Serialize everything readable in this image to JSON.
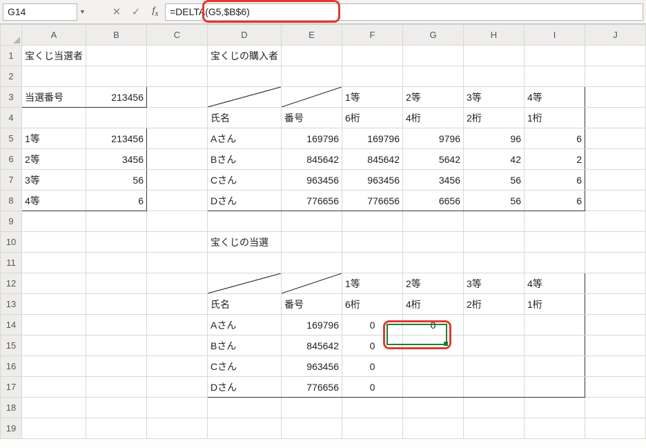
{
  "nameBox": "G14",
  "formula": "=DELTA(G5,$B$6)",
  "columns": [
    "A",
    "B",
    "C",
    "D",
    "E",
    "F",
    "G",
    "H",
    "I",
    "J"
  ],
  "rows": [
    "1",
    "2",
    "3",
    "4",
    "5",
    "6",
    "7",
    "8",
    "9",
    "10",
    "11",
    "12",
    "13",
    "14",
    "15",
    "16",
    "17",
    "18",
    "19"
  ],
  "selectedCol": "G",
  "selectedRow": "14",
  "titles": {
    "winners": "宝くじ当選者",
    "buyers": "宝くじの購入者",
    "results": "宝くじの当選"
  },
  "labels": {
    "winNo": "当選番号",
    "name": "氏名",
    "number": "番号",
    "p1": "1等",
    "p2": "2等",
    "p3": "3等",
    "p4": "4等",
    "d6": "6桁",
    "d4": "4桁",
    "d2": "2桁",
    "d1": "1桁"
  },
  "winNumber": "213456",
  "prizes": [
    {
      "rank": "1等",
      "num": "213456"
    },
    {
      "rank": "2等",
      "num": "3456"
    },
    {
      "rank": "3等",
      "num": "56"
    },
    {
      "rank": "4等",
      "num": "6"
    }
  ],
  "buyers": [
    {
      "name": "Aさん",
      "num": "169796",
      "d6": "169796",
      "d4": "9796",
      "d2": "96",
      "d1": "6"
    },
    {
      "name": "Bさん",
      "num": "845642",
      "d6": "845642",
      "d4": "5642",
      "d2": "42",
      "d1": "2"
    },
    {
      "name": "Cさん",
      "num": "963456",
      "d6": "963456",
      "d4": "3456",
      "d2": "56",
      "d1": "6"
    },
    {
      "name": "Dさん",
      "num": "776656",
      "d6": "776656",
      "d4": "6656",
      "d2": "56",
      "d1": "6"
    }
  ],
  "results": [
    {
      "name": "Aさん",
      "num": "169796",
      "r1": "0",
      "r2": "0",
      "r3": "",
      "r4": ""
    },
    {
      "name": "Bさん",
      "num": "845642",
      "r1": "0",
      "r2": "",
      "r3": "",
      "r4": ""
    },
    {
      "name": "Cさん",
      "num": "963456",
      "r1": "0",
      "r2": "",
      "r3": "",
      "r4": ""
    },
    {
      "name": "Dさん",
      "num": "776656",
      "r1": "0",
      "r2": "",
      "r3": "",
      "r4": ""
    }
  ],
  "icons": {
    "cancel": "✕",
    "enter": "✓"
  }
}
